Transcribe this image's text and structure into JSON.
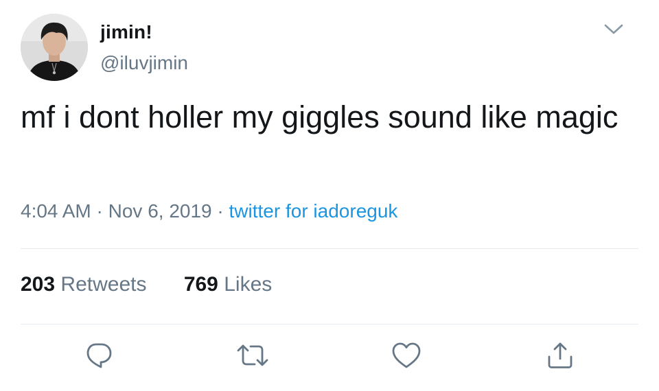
{
  "user": {
    "display_name": "jimin!",
    "handle": "@iluvjimin",
    "avatar": "profile-photo"
  },
  "tweet": {
    "text": "mf i dont holler my giggles sound like magic",
    "time": "4:04 AM",
    "date": "Nov 6, 2019",
    "source": "twitter for iadoreguk"
  },
  "stats": {
    "retweets_count": "203",
    "retweets_label": "Retweets",
    "likes_count": "769",
    "likes_label": "Likes"
  },
  "icons": {
    "caret": "chevron-down-icon",
    "reply": "reply-icon",
    "retweet": "retweet-icon",
    "like": "heart-icon",
    "share": "share-icon"
  },
  "colors": {
    "text": "#14171a",
    "secondary": "#657786",
    "link": "#1b95e0",
    "divider": "#e6ecf0"
  }
}
